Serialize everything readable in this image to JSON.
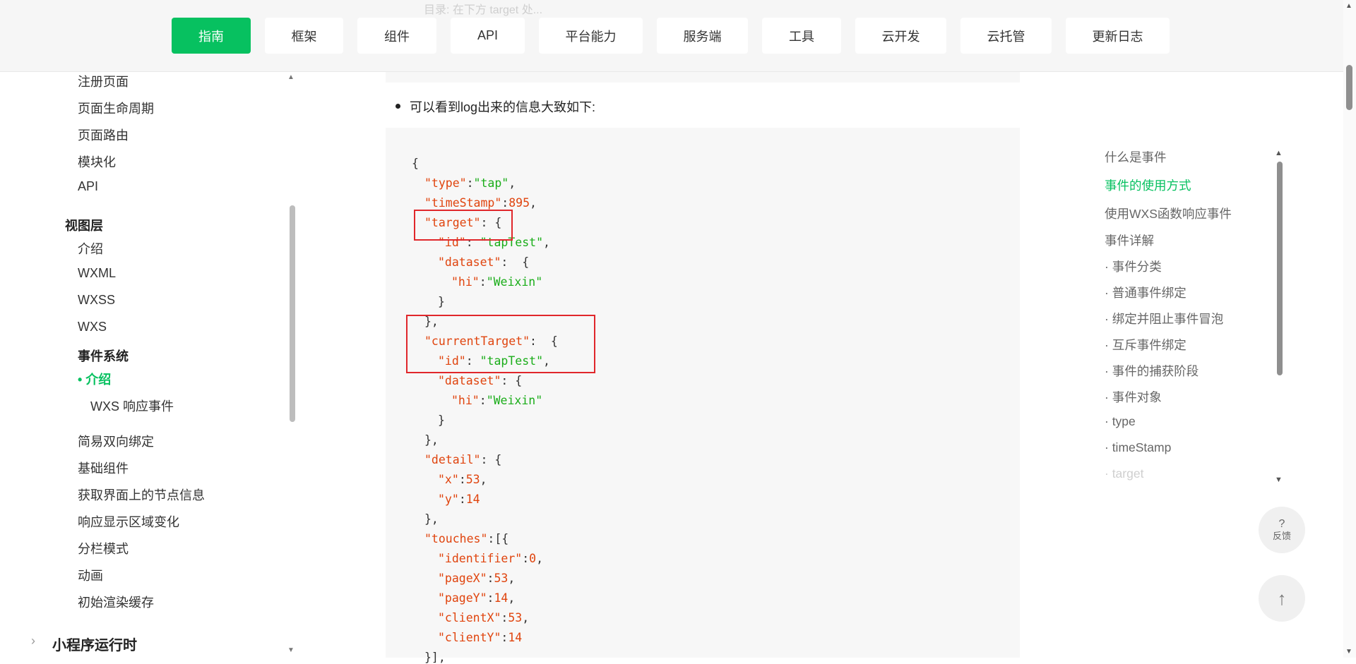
{
  "nav": {
    "ghost_text": "目录: 在下方 target 处...",
    "items": [
      {
        "label": "指南",
        "active": true
      },
      {
        "label": "框架",
        "active": false
      },
      {
        "label": "组件",
        "active": false
      },
      {
        "label": "API",
        "active": false
      },
      {
        "label": "平台能力",
        "active": false
      },
      {
        "label": "服务端",
        "active": false
      },
      {
        "label": "工具",
        "active": false
      },
      {
        "label": "云开发",
        "active": false
      },
      {
        "label": "云托管",
        "active": false
      },
      {
        "label": "更新日志",
        "active": false
      }
    ]
  },
  "sidebar": {
    "items": [
      {
        "label": "注册页面"
      },
      {
        "label": "页面生命周期"
      },
      {
        "label": "页面路由"
      },
      {
        "label": "模块化"
      },
      {
        "label": "API"
      },
      {
        "label": "视图层"
      },
      {
        "label": "介绍"
      },
      {
        "label": "WXML"
      },
      {
        "label": "WXSS"
      },
      {
        "label": "WXS"
      },
      {
        "label": "事件系统"
      },
      {
        "label": "• 介绍"
      },
      {
        "label": "WXS 响应事件"
      },
      {
        "label": "简易双向绑定"
      },
      {
        "label": "基础组件"
      },
      {
        "label": "获取界面上的节点信息"
      },
      {
        "label": "响应显示区域变化"
      },
      {
        "label": "分栏模式"
      },
      {
        "label": "动画"
      },
      {
        "label": "初始渲染缓存"
      },
      {
        "label": "小程序运行时"
      }
    ],
    "chevron": "›",
    "arrow_up": "▲",
    "arrow_down": "▼"
  },
  "content": {
    "bullet_text": "可以看到log出来的信息大致如下:",
    "code": {
      "l1": "{",
      "l2_k": "\"type\"",
      "l2_c": ":",
      "l2_v": "\"tap\"",
      "l2_e": ",",
      "l3_k": "\"timeStamp\"",
      "l3_c": ":",
      "l3_v": "895",
      "l3_e": ",",
      "l4_k": "\"target\"",
      "l4_e": ": {",
      "l5_k": "\"id\"",
      "l5_c": ": ",
      "l5_v": "\"tapTest\"",
      "l5_e": ",",
      "l6_k": "\"dataset\"",
      "l6_e": ":  {",
      "l7_k": "\"hi\"",
      "l7_c": ":",
      "l7_v": "\"Weixin\"",
      "l8": "}",
      "l9": "},",
      "l10_k": "\"currentTarget\"",
      "l10_e": ":  {",
      "l11_k": "\"id\"",
      "l11_c": ": ",
      "l11_v": "\"tapTest\"",
      "l11_e": ",",
      "l12_k": "\"dataset\"",
      "l12_e": ": {",
      "l13_k": "\"hi\"",
      "l13_c": ":",
      "l13_v": "\"Weixin\"",
      "l14": "}",
      "l15": "},",
      "l16_k": "\"detail\"",
      "l16_e": ": {",
      "l17_k": "\"x\"",
      "l17_c": ":",
      "l17_v": "53",
      "l17_e": ",",
      "l18_k": "\"y\"",
      "l18_c": ":",
      "l18_v": "14",
      "l19": "},",
      "l20_k": "\"touches\"",
      "l20_e": ":[{",
      "l21_k": "\"identifier\"",
      "l21_c": ":",
      "l21_v": "0",
      "l21_e": ",",
      "l22_k": "\"pageX\"",
      "l22_c": ":",
      "l22_v": "53",
      "l22_e": ",",
      "l23_k": "\"pageY\"",
      "l23_c": ":",
      "l23_v": "14",
      "l23_e": ",",
      "l24_k": "\"clientX\"",
      "l24_c": ":",
      "l24_v": "53",
      "l24_e": ",",
      "l25_k": "\"clientY\"",
      "l25_c": ":",
      "l25_v": "14",
      "l26": "}],"
    }
  },
  "toc": {
    "items": [
      {
        "label": "什么是事件"
      },
      {
        "label": "事件的使用方式"
      },
      {
        "label": "使用WXS函数响应事件"
      },
      {
        "label": "事件详解"
      },
      {
        "label": "· 事件分类"
      },
      {
        "label": "· 普通事件绑定"
      },
      {
        "label": "· 绑定并阻止事件冒泡"
      },
      {
        "label": "· 互斥事件绑定"
      },
      {
        "label": "· 事件的捕获阶段"
      },
      {
        "label": "· 事件对象"
      },
      {
        "label": "· type"
      },
      {
        "label": "· timeStamp"
      },
      {
        "label": "· target"
      }
    ],
    "arrow_up": "▲",
    "arrow_down": "▼"
  },
  "float": {
    "feedback_icon": "?",
    "feedback_label": "反馈",
    "top_icon": "↑"
  },
  "window": {
    "arrow_up": "▲",
    "arrow_down": "▼"
  },
  "colors": {
    "accent": "#07c160",
    "highlight_box": "#e0272b",
    "code_key": "#e0440e",
    "code_string": "#1aad19"
  }
}
